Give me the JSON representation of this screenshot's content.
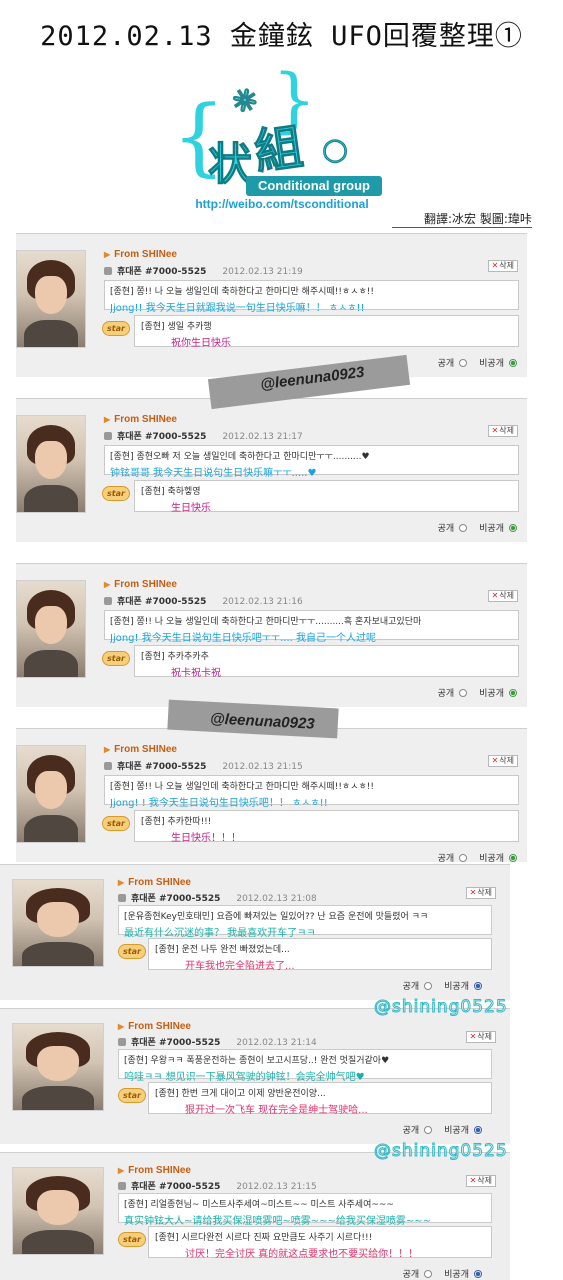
{
  "header": {
    "title": "2012.02.13 金鐘鉉 UFO回覆整理①"
  },
  "logo": {
    "chars": [
      "状",
      "組"
    ],
    "group_label": "Conditional group",
    "url": "http://weibo.com/tsconditional"
  },
  "credits": {
    "text": "翻譯:冰宏    製圖:瑋咔"
  },
  "watermarks": [
    "@leenuna0923",
    "@leenuna0923",
    "@shining0525",
    "@shining0525"
  ],
  "posts": [
    {
      "from": "From SHINee",
      "phone_label": "휴대폰",
      "phone_no": "#7000-5525",
      "date": "2012.02.13 21:19",
      "delete_label": "삭제",
      "message": "[종현] 쫑!! 나 오늘 생일인데 축하한다고 한마디만 해주시떼!!ㅎㅅㅎ!!",
      "message_tr": "Jjong!! 我今天生日就跟我说一句生日快乐嘛！！ ㅎㅅㅎ!!",
      "reply": "[종현] 생일 추카행",
      "reply_tr": "祝你生日快乐",
      "public_label": "공개",
      "private_label": "비공개",
      "selected": "private"
    },
    {
      "from": "From SHINee",
      "phone_label": "휴대폰",
      "phone_no": "#7000-5525",
      "date": "2012.02.13 21:17",
      "delete_label": "삭제",
      "message": "[종현] 종현오빠 저 오늘 생일인데 축하한다고 한마디만ㅜㅜ..........♥",
      "message_tr": "钟铉哥哥 我今天生日说句生日快乐嘛ㅜㅜ.....♥",
      "reply": "[종현] 축하헿영",
      "reply_tr": "生日快乐",
      "public_label": "공개",
      "private_label": "비공개",
      "selected": "private"
    },
    {
      "from": "From SHINee",
      "phone_label": "휴대폰",
      "phone_no": "#7000-5525",
      "date": "2012.02.13 21:16",
      "delete_label": "삭제",
      "message": "[종현] 쫑!! 나 오늘 생일인데 축하한다고 한마디만ㅜㅜ..........흑 혼자보내고있단마",
      "message_tr": "Jjong! 我今天生日说句生日快乐吧ㅜㅜ.... 我自己一个人过呢",
      "reply": "[종현] 추카추카추",
      "reply_tr": "祝卡祝卡祝",
      "public_label": "공개",
      "private_label": "비공개",
      "selected": "private"
    },
    {
      "from": "From SHINee",
      "phone_label": "휴대폰",
      "phone_no": "#7000-5525",
      "date": "2012.02.13 21:15",
      "delete_label": "삭제",
      "message": "[종현] 쫑!! 나 오늘 생일인데 축하한다고 한마디만 해주시떼!!ㅎㅅㅎ!!",
      "message_tr": "Jjong! ! 我今天生日说句生日快乐吧！！ ㅎㅅㅎ!!",
      "reply": "[종현] 추카한따!!!",
      "reply_tr": "生日快乐！！！",
      "public_label": "공개",
      "private_label": "비공개",
      "selected": "private"
    },
    {
      "from": "From SHINee",
      "phone_label": "휴대폰",
      "phone_no": "#7000-5525",
      "date": "2012.02.13 21:08",
      "delete_label": "삭제",
      "message": "[운유종현Key민호태민] 요즘에 빠져있는 일있어?? 난 요즘 운전에 맛들렸어 ㅋㅋ",
      "message_tr": "最近有什么沉迷的事？ 我最喜欢开车了ㅋㅋ",
      "reply": "[종현] 운전 나두 완전 빠졌었는데...",
      "reply_tr": "开车我也完全陷进去了...",
      "public_label": "공개",
      "private_label": "비공개",
      "selected": "private"
    },
    {
      "from": "From SHINee",
      "phone_label": "휴대폰",
      "phone_no": "#7000-5525",
      "date": "2012.02.13 21:14",
      "delete_label": "삭제",
      "message": "[종현] 우왕ㅋㅋ 폭풍운전하는 종현이 보고시프당..! 완전 멋질거같아♥",
      "message_tr": "呜哇ㅋㅋ 想见识一下暴风驾驶的钟铉！会完全帅气吧♥",
      "reply": "[종현] 한번 크게 대이고 이제 양반운전이양...",
      "reply_tr": "狠开过一次飞车 现在完全是绅士驾驶哈...",
      "public_label": "공개",
      "private_label": "비공개",
      "selected": "private"
    },
    {
      "from": "From SHINee",
      "phone_label": "휴대폰",
      "phone_no": "#7000-5525",
      "date": "2012.02.13 21:15",
      "delete_label": "삭제",
      "message": "[종현] 리얼종현님~ 미스트사주세여~미스트~~ 미스트 사주세여~~~",
      "message_tr": "真实钟铉大人~请给我买保湿喷雾吧~喷雾~~~给我买保湿喷雾~~~",
      "reply": "[종현] 시르다완전 시르다 진짜 요만큼도 사주기 시르다!!!",
      "reply_tr": "讨厌！完全讨厌 真的就这点要求也不要买给你！！！",
      "public_label": "공개",
      "private_label": "비공개",
      "selected": "private"
    }
  ]
}
